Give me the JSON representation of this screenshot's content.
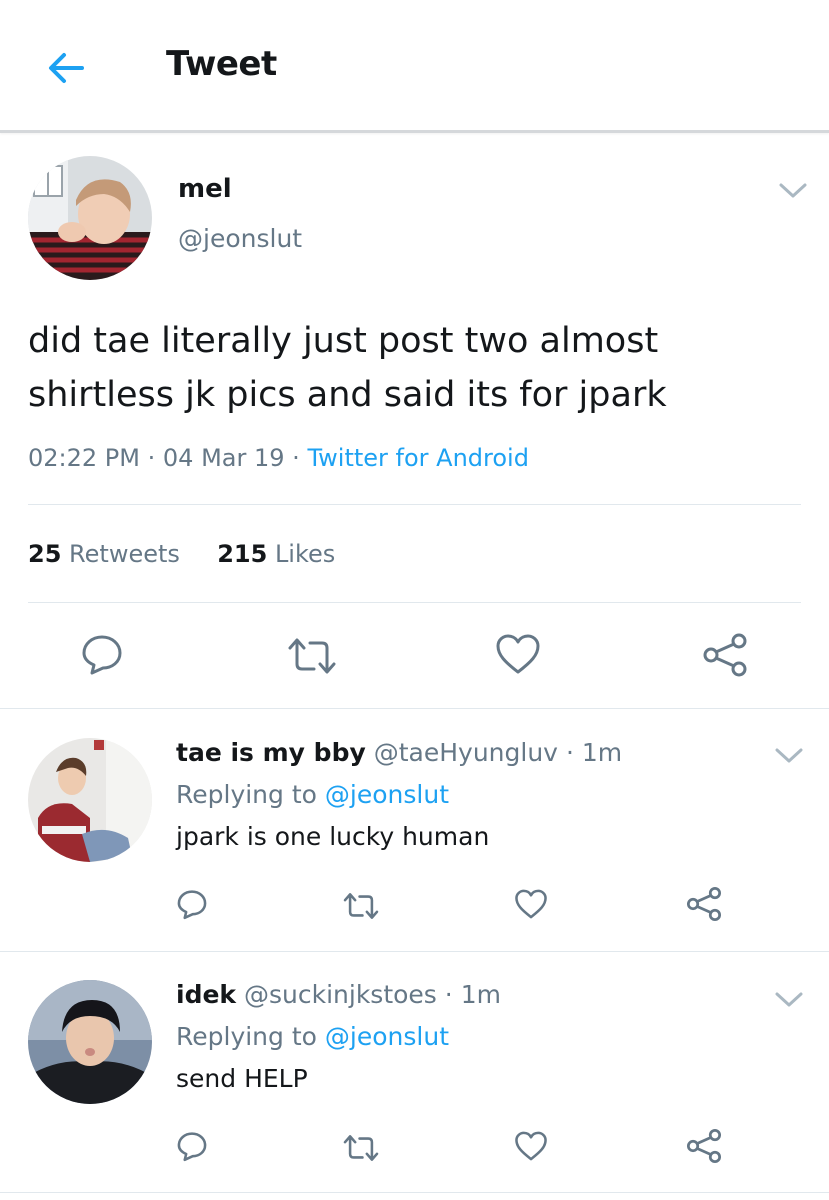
{
  "header": {
    "title": "Tweet",
    "back_icon": "back-arrow-icon"
  },
  "tweet": {
    "author_name": "mel",
    "author_handle": "@jeonslut",
    "text": "did tae literally just post two almost shirtless jk pics and said its for jpark",
    "time": "02:22 PM",
    "dot1": "·",
    "date": "04 Mar 19",
    "dot2": "·",
    "source": "Twitter for Android",
    "retweets_count": "25",
    "retweets_label": "Retweets",
    "likes_count": "215",
    "likes_label": "Likes"
  },
  "replies": [
    {
      "name": "tae is my bby",
      "handle": "@taeHyungluv",
      "dot": "·",
      "time": "1m",
      "replying_prefix": "Replying to",
      "replying_to": "@jeonslut",
      "text": "jpark is one lucky human"
    },
    {
      "name": "idek",
      "handle": "@suckinjkstoes",
      "dot": "·",
      "time": "1m",
      "replying_prefix": "Replying to",
      "replying_to": "@jeonslut",
      "text": "send HELP"
    }
  ],
  "colors": {
    "accent": "#1da1f2",
    "muted": "#657786",
    "text": "#14171a",
    "divider": "#e1e8ed"
  },
  "icons": [
    "back-arrow-icon",
    "chevron-down-icon",
    "reply-icon",
    "retweet-icon",
    "like-icon",
    "share-icon"
  ]
}
